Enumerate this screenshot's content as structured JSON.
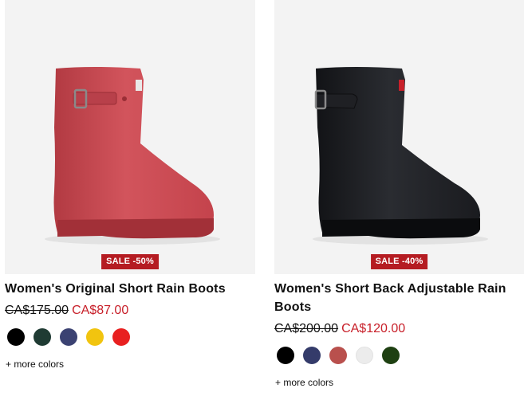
{
  "products": [
    {
      "badge": "SALE -50%",
      "name": "Women's Original Short Rain Boots",
      "old_price": "CA$175.00",
      "sale_price": "CA$87.00",
      "boot_color": "#c8444c",
      "swatches": [
        {
          "color": "#000000"
        },
        {
          "color": "#1f3b33"
        },
        {
          "color": "#3b4272"
        },
        {
          "color": "#f1c40f"
        },
        {
          "color": "#e82020"
        }
      ],
      "more_colors": "+ more colors"
    },
    {
      "badge": "SALE -40%",
      "name": "Women's Short Back Adjustable Rain Boots",
      "old_price": "CA$200.00",
      "sale_price": "CA$120.00",
      "boot_color": "#1c1d20",
      "swatches": [
        {
          "color": "#000000"
        },
        {
          "color": "#343b6a"
        },
        {
          "color": "#b9504d"
        },
        {
          "color": "#ececec"
        },
        {
          "color": "#1e4012"
        }
      ],
      "more_colors": "+ more colors"
    }
  ]
}
